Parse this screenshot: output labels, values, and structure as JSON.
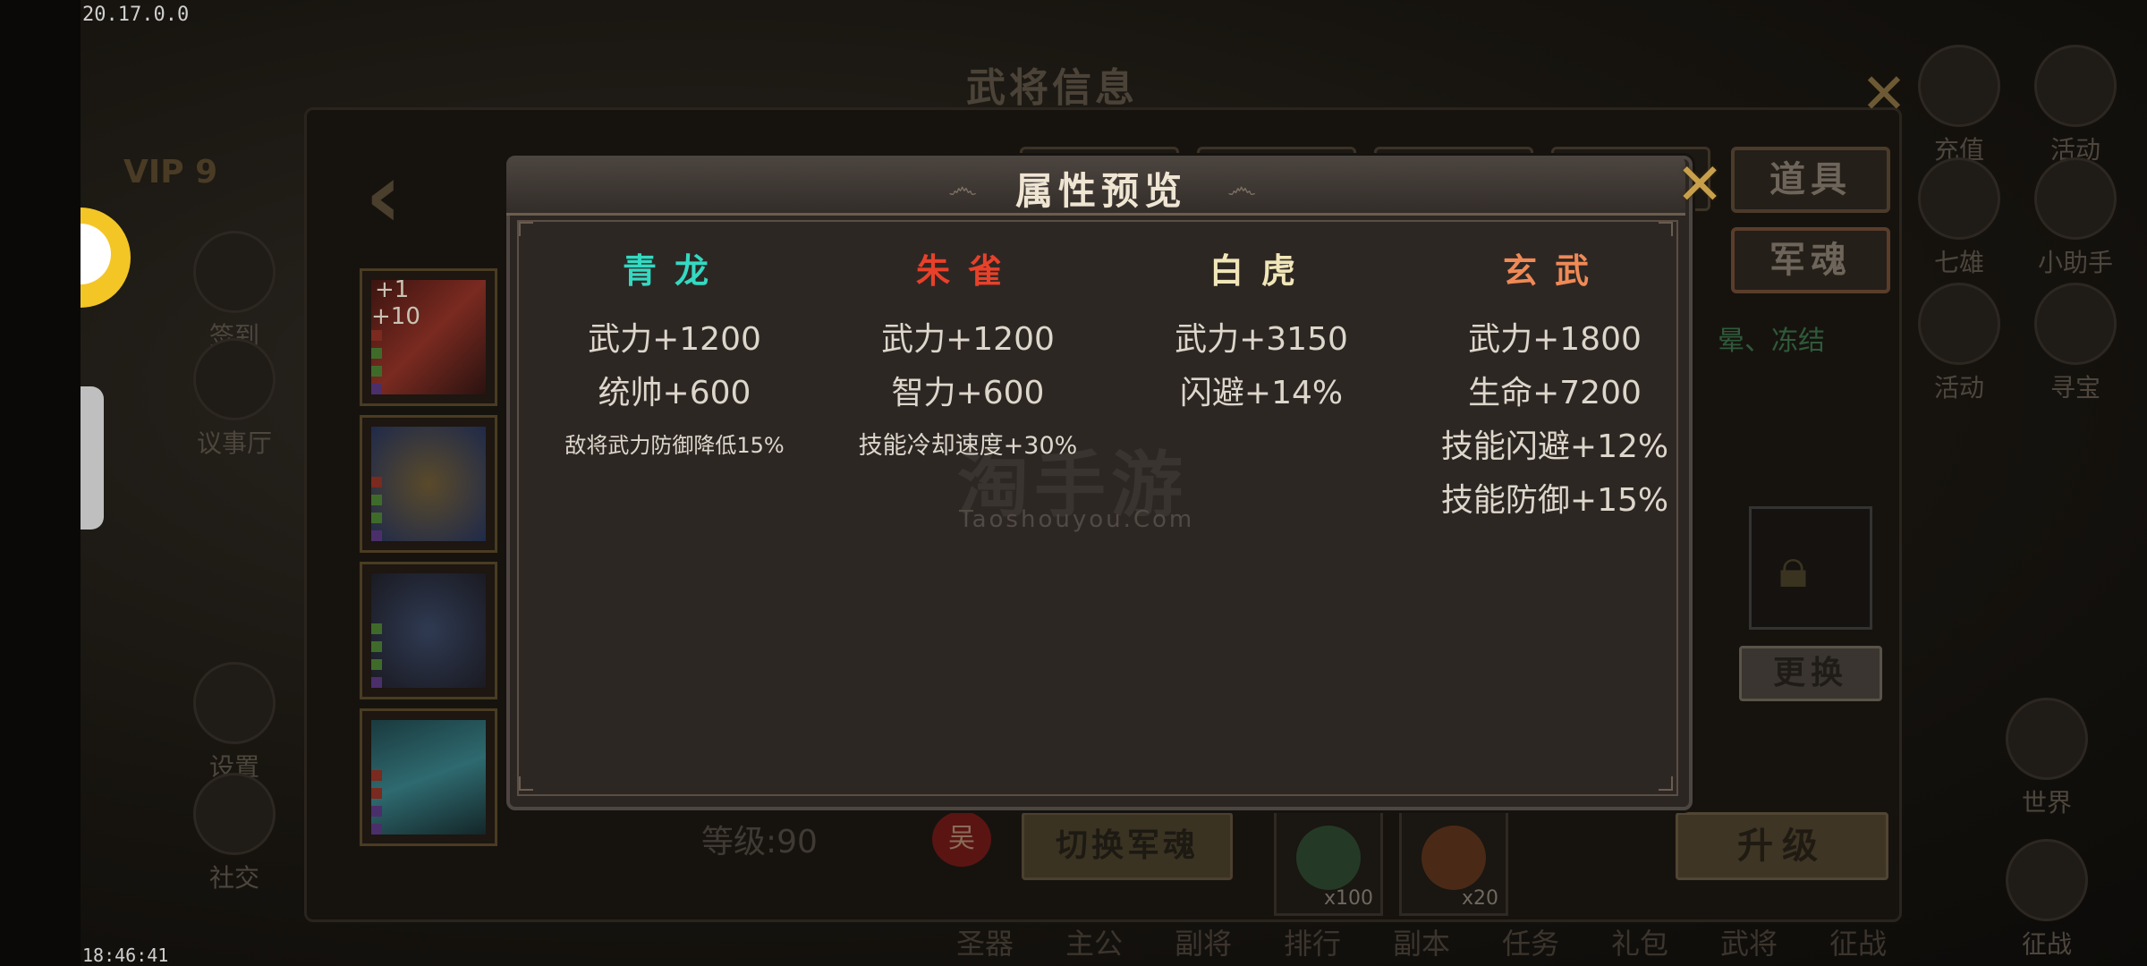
{
  "status": {
    "version": "20.17.0.0",
    "time": "18:46:41"
  },
  "hero_panel": {
    "title": "武将信息",
    "vip": "VIP 9",
    "tabs": [
      "道具",
      "军魂"
    ],
    "left_menu": [
      "签到",
      "议事厅",
      "设置",
      "社交"
    ],
    "right_menu": [
      "充值",
      "活动",
      "七雄",
      "小助手",
      "活动",
      "寻宝",
      "世界",
      "征战"
    ],
    "right_hint": "晕、冻结",
    "swap_label": "更换",
    "level_label": "等级:90",
    "level_badge": "吴",
    "switch_label": "切换军魂",
    "consumables": [
      {
        "icon": "jade-orb-icon",
        "count": "x100"
      },
      {
        "icon": "fire-orb-icon",
        "count": "x20"
      }
    ],
    "upgrade_label": "升级",
    "bottom_menu": [
      "圣器",
      "主公",
      "副将",
      "排行",
      "副本",
      "任务",
      "礼包",
      "武将",
      "征战"
    ]
  },
  "slots": [
    {
      "icon": "weapon-icon",
      "plus_top": "+1",
      "plus_sub": "+10"
    },
    {
      "icon": "dragon-emblem-icon"
    },
    {
      "icon": "beast-icon"
    },
    {
      "icon": "crystal-icon"
    }
  ],
  "modal": {
    "title": "属性预览",
    "columns": [
      {
        "name": "青龙",
        "color": "#34d9c2",
        "stats": [
          "武力+1200",
          "统帅+600"
        ],
        "extra": "敌将武力防御降低15%"
      },
      {
        "name": "朱雀",
        "color": "#e8412a",
        "stats": [
          "武力+1200",
          "智力+600"
        ],
        "extra": "技能冷却速度+30%"
      },
      {
        "name": "白虎",
        "color": "#f1e6b8",
        "stats": [
          "武力+3150",
          "闪避+14%"
        ]
      },
      {
        "name": "玄武",
        "color": "#ef8a56",
        "stats": [
          "武力+1800",
          "生命+7200",
          "技能闪避+12%",
          "技能防御+15%"
        ]
      }
    ]
  },
  "watermark": {
    "text": "淘手游",
    "url": "Taoshouyou.Com"
  }
}
